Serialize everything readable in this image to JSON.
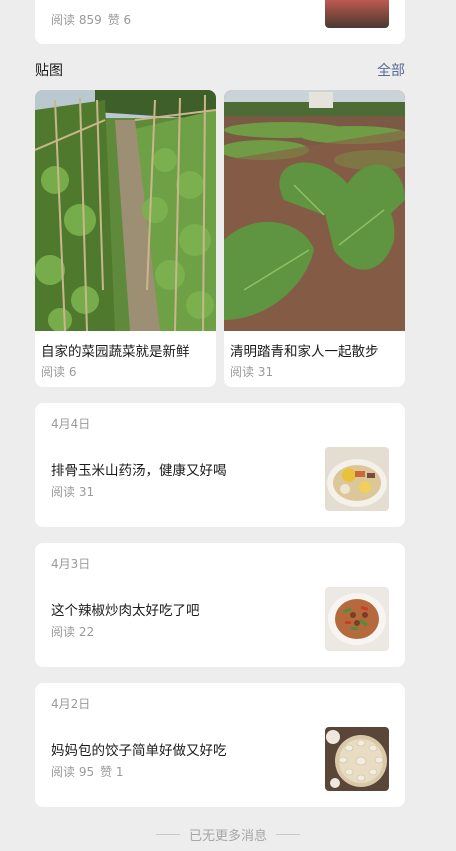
{
  "previous_article": {
    "reads": "阅读 859",
    "likes": "赞 6",
    "thumb_icon": "article-thumbnail-image"
  },
  "photo_section": {
    "title": "贴图",
    "all_link": "全部",
    "items": [
      {
        "title": "自家的菜园蔬菜就是新鲜",
        "reads": "阅读 6",
        "image": "vegetable-garden-photo"
      },
      {
        "title": "清明踏青和家人一起散步",
        "reads": "阅读 31",
        "image": "tobacco-field-photo"
      }
    ]
  },
  "articles": [
    {
      "date": "4月4日",
      "title": "排骨玉米山药汤，健康又好喝",
      "reads": "阅读 31",
      "likes": "",
      "image": "soup-photo"
    },
    {
      "date": "4月3日",
      "title": "这个辣椒炒肉太好吃了吧",
      "reads": "阅读 22",
      "likes": "",
      "image": "stir-fry-photo"
    },
    {
      "date": "4月2日",
      "title": "妈妈包的饺子简单好做又好吃",
      "reads": "阅读 95",
      "likes": "赞 1",
      "image": "dumplings-photo"
    }
  ],
  "footer": {
    "text": "已无更多消息"
  },
  "colors": {
    "background": "#ededed",
    "card": "#ffffff",
    "link": "#576b95",
    "muted": "#9a9a9a"
  }
}
